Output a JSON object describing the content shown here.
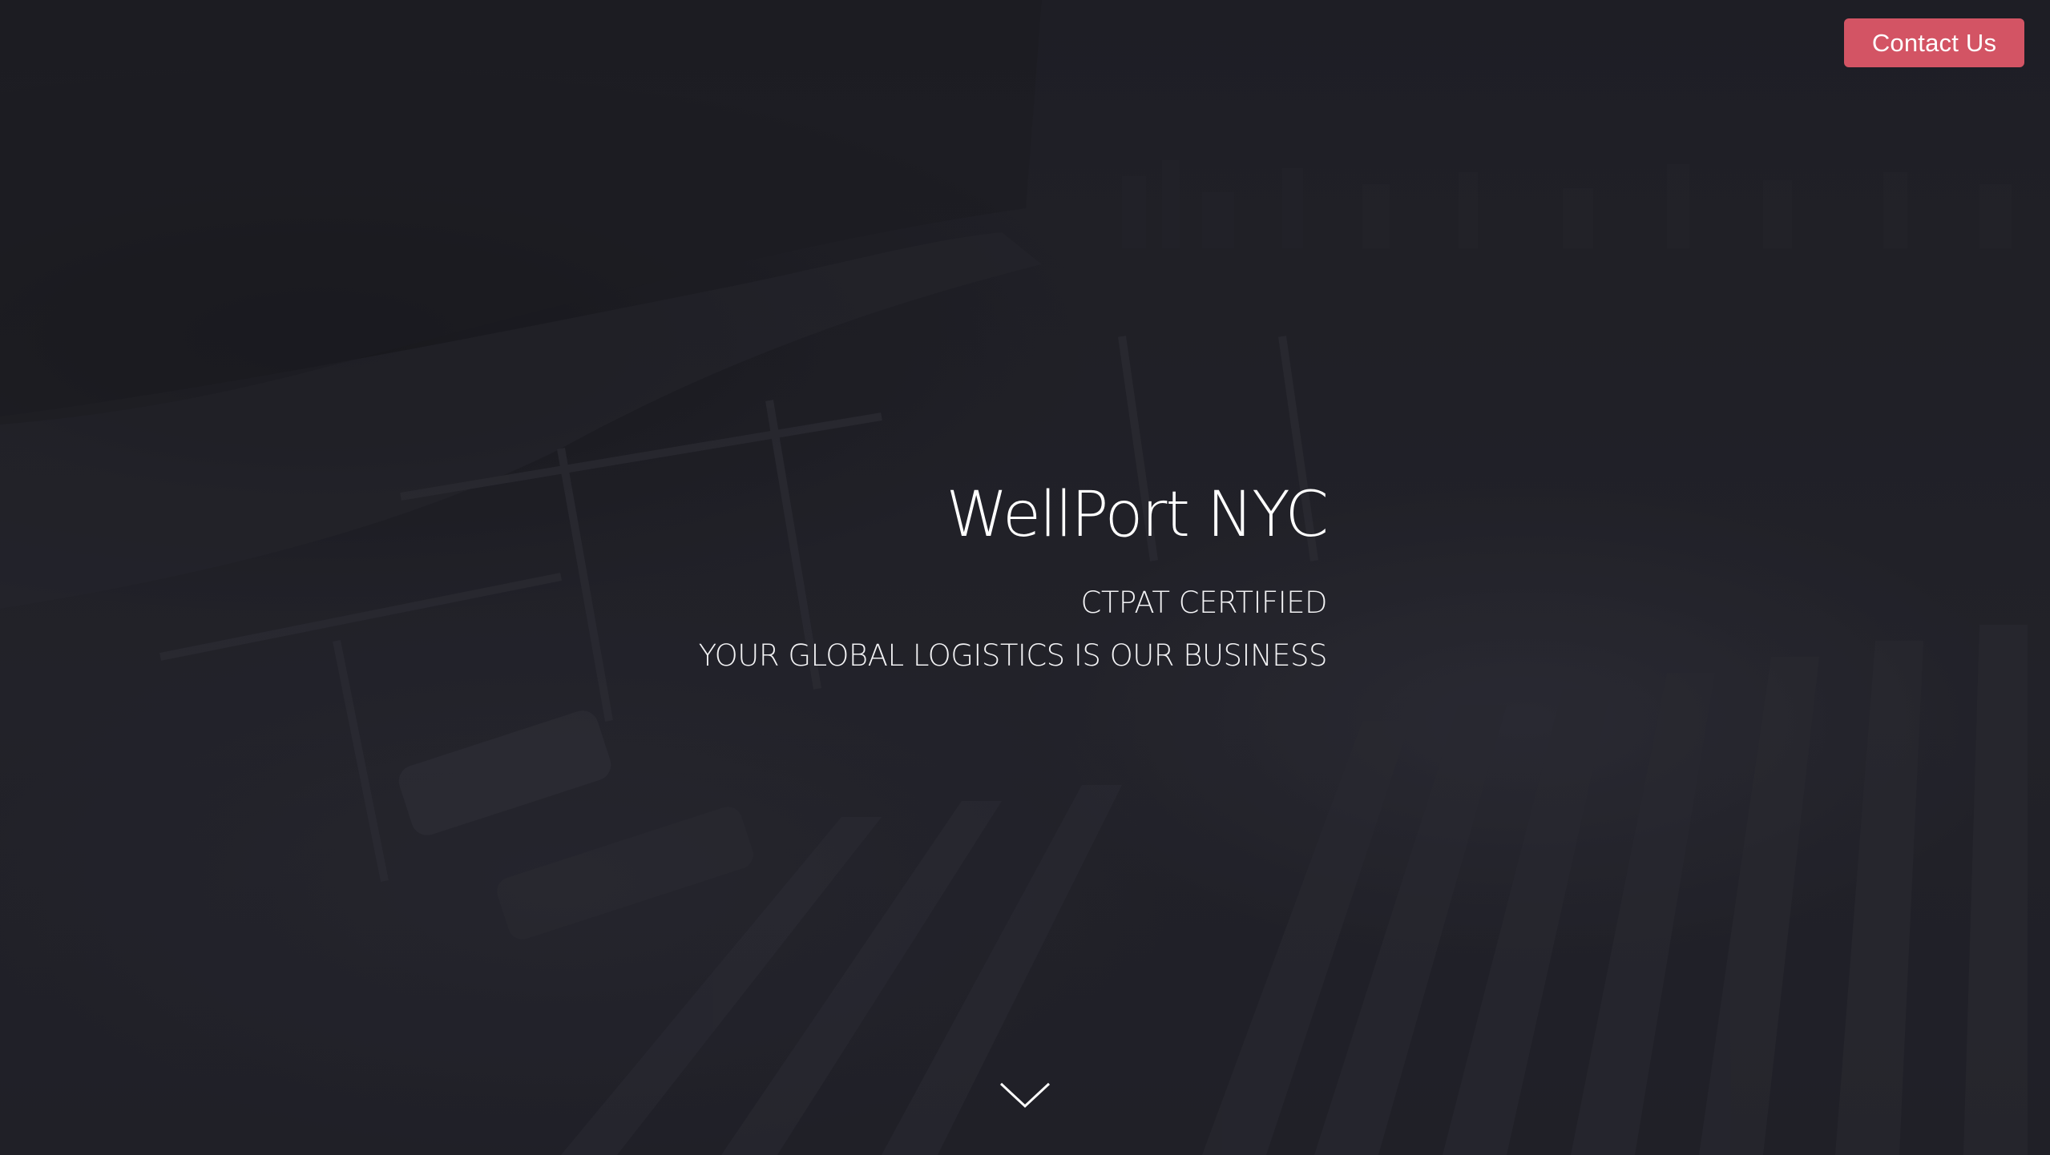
{
  "header": {
    "contact_button_label": "Contact Us"
  },
  "hero": {
    "title": "WellPort NYC",
    "sublines": [
      "CTPAT CERTIFIED",
      "YOUR GLOBAL LOGISTICS IS OUR BUSINESS"
    ],
    "scroll_icon": "chevron-down-icon"
  },
  "colors": {
    "background": "#1f1f26",
    "accent": "#d35464",
    "text": "#ffffff"
  }
}
